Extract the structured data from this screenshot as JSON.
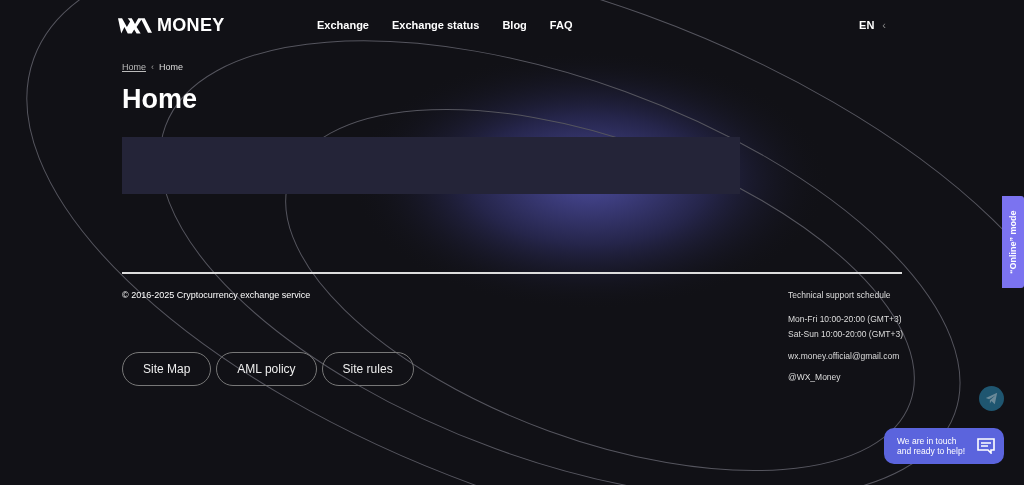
{
  "header": {
    "logo": "MONEY",
    "nav": [
      "Exchange",
      "Exchange status",
      "Blog",
      "FAQ"
    ],
    "language": "EN",
    "language_caret": "‹"
  },
  "breadcrumbs": [
    {
      "label": "Home",
      "link": true
    },
    {
      "label": "Home",
      "link": false
    }
  ],
  "breadcrumb_separator": "‹",
  "page_title": "Home",
  "footer": {
    "copyright": "© 2016-2025 Cryptocurrency exchange service",
    "links": [
      "Site Map",
      "AML policy",
      "Site rules"
    ],
    "support": [
      "Technical support schedule",
      "Mon-Fri 10:00-20:00 (GMT+3)",
      "Sat-Sun 10:00-20:00 (GMT+3)",
      "wx.money.official@gmail.com",
      "@WX_Money"
    ]
  },
  "online_mode_tab": "“Online” mode",
  "chat_button": "We are in touch and ready to help!"
}
